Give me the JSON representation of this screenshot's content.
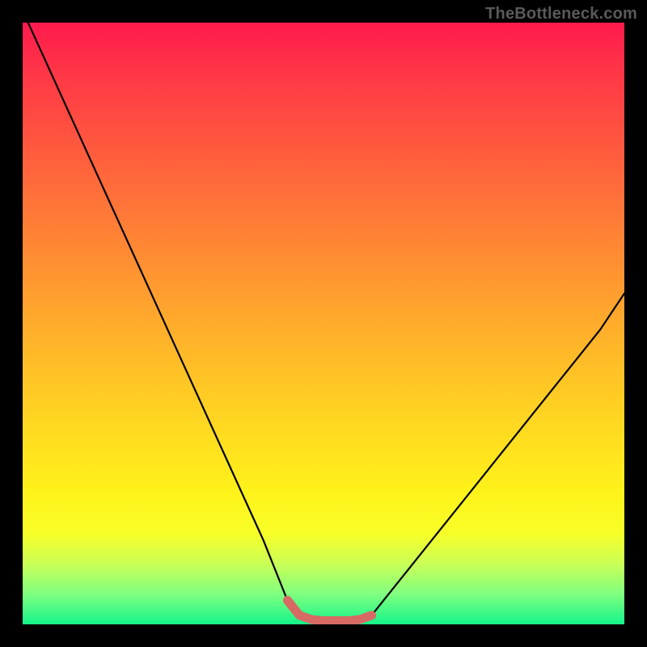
{
  "watermark": "TheBottleneck.com",
  "colors": {
    "curve_stroke": "#000000",
    "highlight_stroke": "#d76a63",
    "gradient_top": "#ff1a4d",
    "gradient_bottom": "#14f58a",
    "frame": "#000000"
  },
  "chart_data": {
    "type": "line",
    "title": "",
    "xlabel": "",
    "ylabel": "",
    "xlim": [
      0,
      100
    ],
    "ylim": [
      0,
      100
    ],
    "grid": false,
    "legend": false,
    "series": [
      {
        "name": "bottleneck-curve",
        "x": [
          0,
          5,
          10,
          15,
          20,
          25,
          30,
          35,
          40,
          44,
          46,
          48,
          50,
          52,
          54,
          56,
          58,
          60,
          64,
          68,
          72,
          76,
          80,
          84,
          88,
          92,
          96,
          100
        ],
        "y": [
          102,
          91,
          80,
          69,
          58,
          47,
          36,
          25,
          14,
          4,
          1.5,
          0.8,
          0.6,
          0.6,
          0.6,
          0.8,
          1.5,
          4,
          9,
          14,
          19,
          24,
          29,
          34,
          39,
          44,
          49,
          55
        ]
      },
      {
        "name": "sweet-spot-highlight",
        "x": [
          44,
          46,
          48,
          50,
          52,
          54,
          56,
          58
        ],
        "y": [
          4,
          1.5,
          0.8,
          0.6,
          0.6,
          0.6,
          0.8,
          1.5
        ]
      }
    ]
  }
}
